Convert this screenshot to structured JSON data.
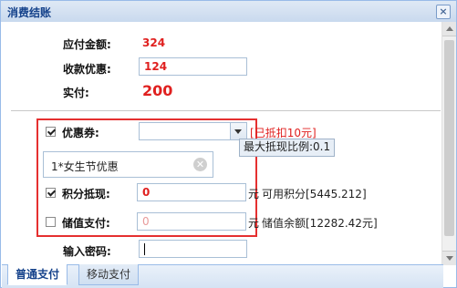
{
  "window": {
    "title": "消费结账",
    "close_label": "×"
  },
  "summary": {
    "payable_label": "应付金额:",
    "payable_value": "324",
    "discount_label": "收款优惠:",
    "discount_value": "124",
    "actual_label": "实付:",
    "actual_value": "200"
  },
  "coupon": {
    "checked": true,
    "label": "优惠券:",
    "selected_value": "",
    "deducted_note": "已抵扣10元]",
    "tooltip": "最大抵现比例:0.1",
    "tag_text": "1*女生节优惠",
    "tag_remove": "✕"
  },
  "points": {
    "checked": true,
    "label": "积分抵现:",
    "value": "0",
    "unit": "元",
    "available": "可用积分[5445.212]"
  },
  "stored_value": {
    "checked": false,
    "label": "储值支付:",
    "value": "0",
    "unit": "元",
    "balance": "储值余额[12282.42元]"
  },
  "password": {
    "label": "输入密码:",
    "value": ""
  },
  "tabs": [
    {
      "label": "普通支付",
      "active": true
    },
    {
      "label": "移动支付",
      "active": false
    }
  ],
  "colors": {
    "accent_red": "#e0201f",
    "header_blue": "#15428b",
    "border_blue": "#99bbe8"
  }
}
